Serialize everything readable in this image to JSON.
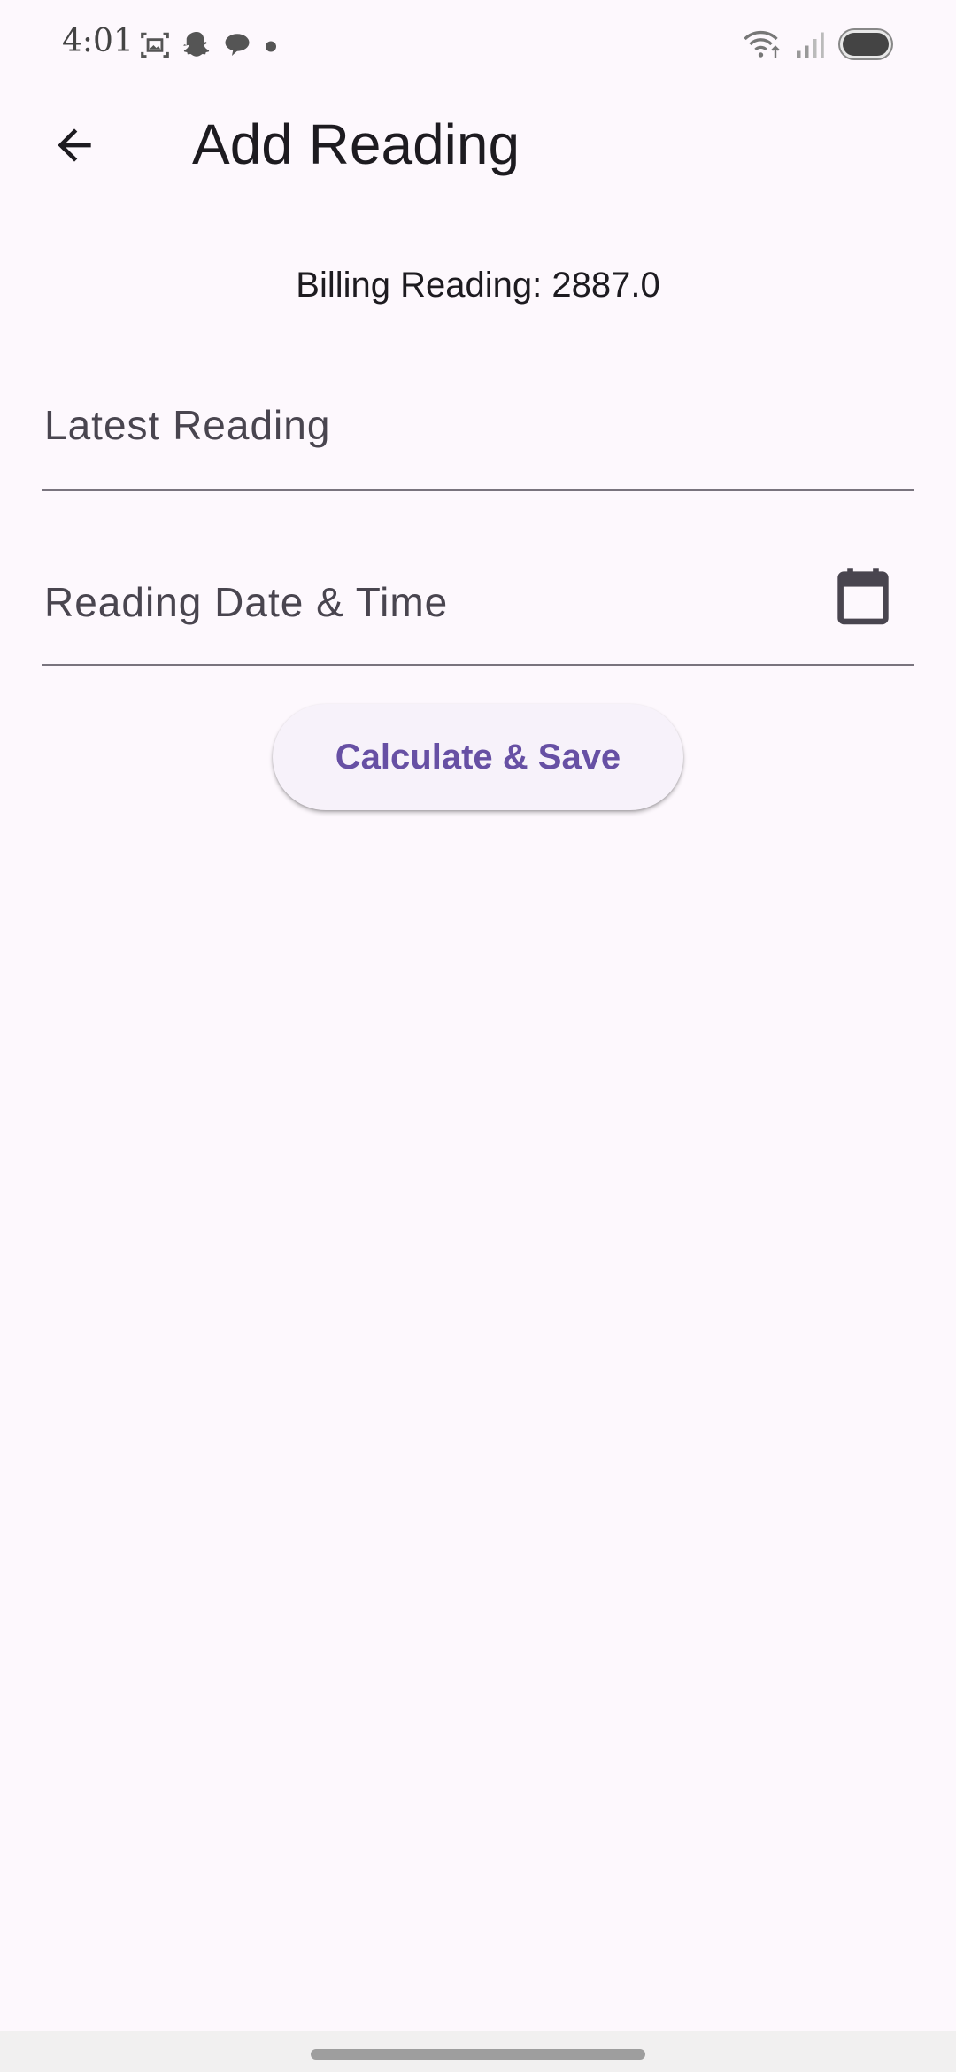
{
  "status_bar": {
    "time": "4:01",
    "left_icons": [
      "screenshot-icon",
      "snapchat-icon",
      "chat-icon",
      "dot-icon"
    ],
    "right_icons": [
      "wifi-icon",
      "signal-icon",
      "battery-icon"
    ]
  },
  "app_bar": {
    "back_icon": "arrow-back-icon",
    "title": "Add Reading"
  },
  "billing": {
    "text": "Billing Reading: 2887.0"
  },
  "form": {
    "latest_reading": {
      "placeholder": "Latest Reading",
      "value": ""
    },
    "reading_date": {
      "placeholder": "Reading Date & Time",
      "value": "",
      "icon": "calendar-icon"
    }
  },
  "actions": {
    "calculate_label": "Calculate & Save"
  },
  "colors": {
    "background": "#fdf8fd",
    "accent": "#6750a4",
    "underline": "#79747e",
    "button_bg": "#f7f2fa"
  }
}
